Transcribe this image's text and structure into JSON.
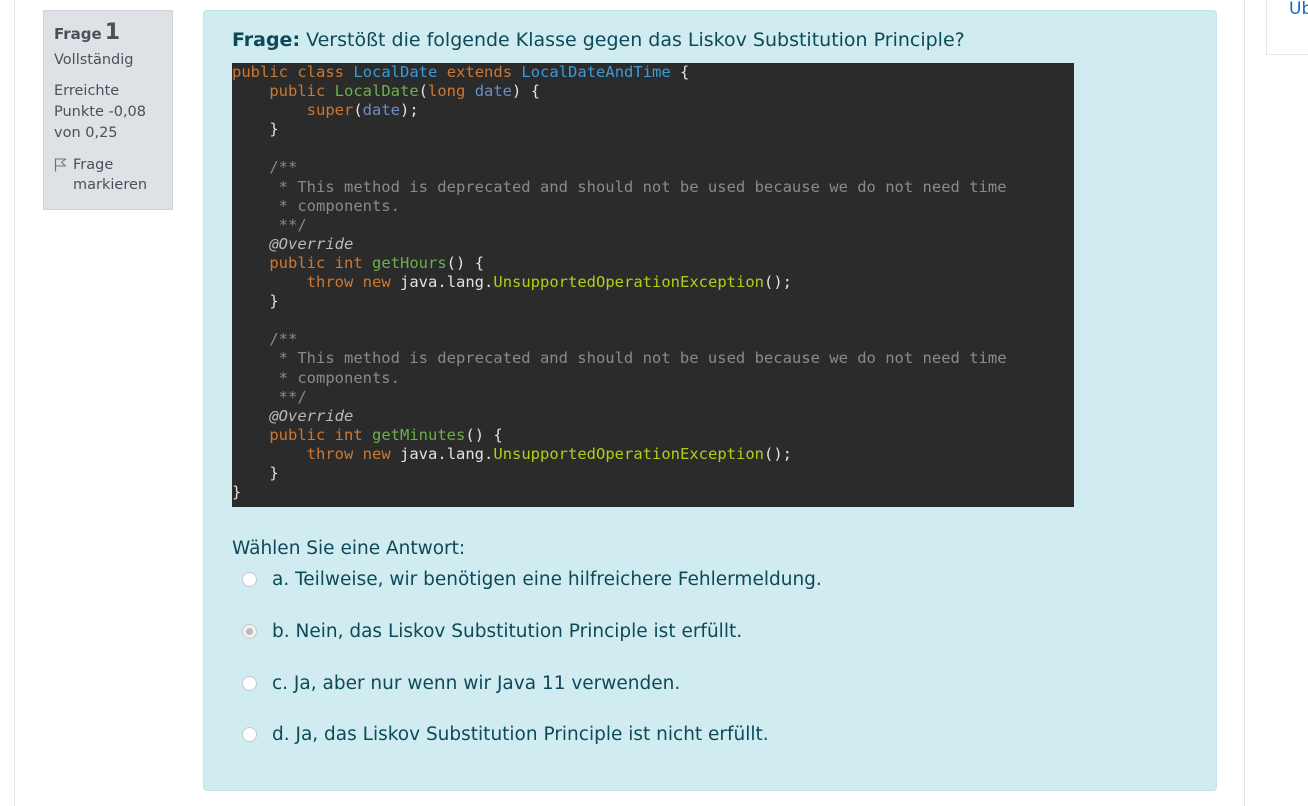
{
  "side": {
    "link_label": "Üb"
  },
  "info": {
    "question_label": "Frage",
    "question_number": "1",
    "state": "Vollständig",
    "grade_line1": "Erreichte",
    "grade_line2": "Punkte -0,08",
    "grade_line3": "von 0,25",
    "flag_line1": "Frage",
    "flag_line2": "markieren",
    "flag_icon": "flag-outline-icon"
  },
  "question": {
    "label": "Frage:",
    "text": "Verstößt die folgende Klasse gegen das Liskov Substitution Principle?",
    "code_lines": [
      "public class LocalDate extends LocalDateAndTime {",
      "    public LocalDate(long date) {",
      "        super(date);",
      "    }",
      "",
      "    /**",
      "     * This method is deprecated and should not be used because we do not need time",
      "     * components.",
      "     **/",
      "    @Override",
      "    public int getHours() {",
      "        throw new java.lang.UnsupportedOperationException();",
      "    }",
      "",
      "    /**",
      "     * This method is deprecated and should not be used because we do not need time",
      "     * components.",
      "     **/",
      "    @Override",
      "    public int getMinutes() {",
      "        throw new java.lang.UnsupportedOperationException();",
      "    }",
      "}"
    ],
    "prompt": "Wählen Sie eine Antwort:",
    "answers": [
      {
        "label": "a. Teilweise, wir benötigen eine hilfreichere Fehlermeldung.",
        "selected": false
      },
      {
        "label": "b. Nein, das Liskov Substitution Principle ist erfüllt.",
        "selected": true
      },
      {
        "label": "c. Ja, aber nur wenn wir Java 11 verwenden.",
        "selected": false
      },
      {
        "label": "d. Ja, das Liskov Substitution Principle ist nicht erfüllt.",
        "selected": false
      }
    ]
  },
  "colors": {
    "content_bg": "#d1ecf1",
    "info_bg": "#dee2e6",
    "code_bg": "#2b2b2b",
    "text": "#0c4a5a",
    "link": "#0f6cbf"
  }
}
